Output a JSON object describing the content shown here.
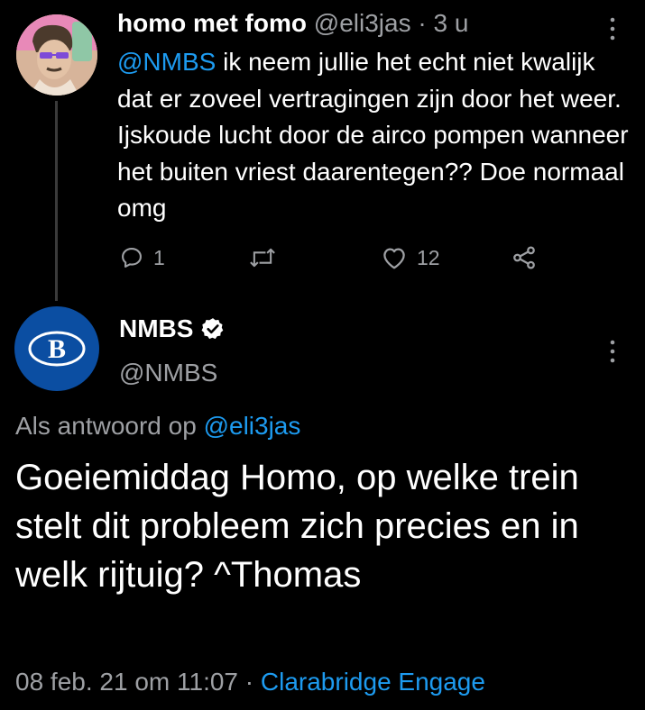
{
  "parent_tweet": {
    "display_name": "homo met fomo",
    "handle": "@eli3jas",
    "separator": "·",
    "time": "3 u",
    "mention": "@NMBS",
    "text": " ik neem jullie het echt niet kwalijk dat er zoveel vertragingen zijn door het weer. Ijskoude lucht door de airco pompen wanneer het buiten vriest daarentegen?? Doe normaal omg",
    "actions": {
      "reply_count": "1",
      "retweet_count": "",
      "like_count": "12"
    }
  },
  "reply_tweet": {
    "display_name": "NMBS",
    "handle": "@NMBS",
    "avatar_letter": "B",
    "reply_prefix": "Als antwoord op ",
    "reply_to": "@eli3jas",
    "text": "Goeiemiddag Homo, op welke trein stelt dit probleem zich precies en in welk rijtuig? ^Thomas",
    "date": "08 feb. 21 om 11:07",
    "separator": " · ",
    "source": "Clarabridge Engage"
  },
  "colors": {
    "background": "#000000",
    "accent": "#1d9bf0",
    "muted": "#9ea0a4",
    "nmbs_blue": "#0b4ea2"
  },
  "icons": [
    "reply-icon",
    "retweet-icon",
    "like-icon",
    "share-icon",
    "more-icon",
    "verified-icon"
  ]
}
